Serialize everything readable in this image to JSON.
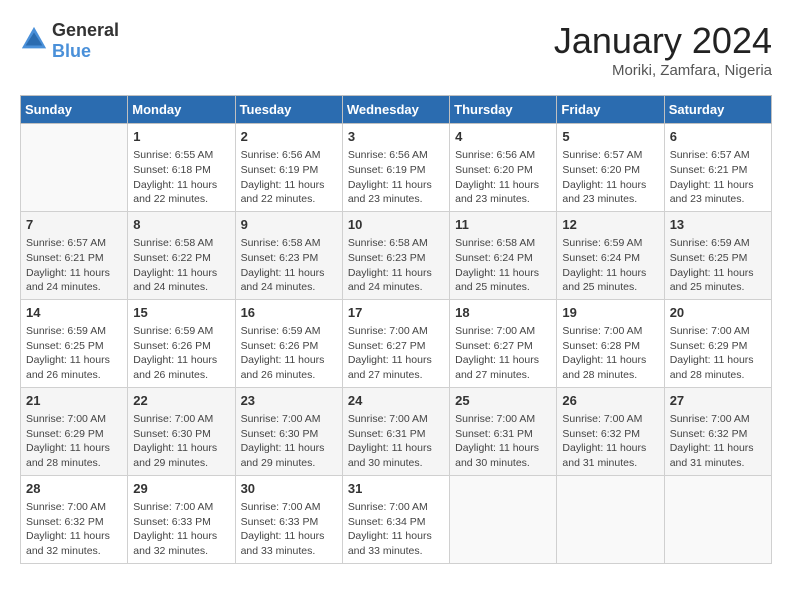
{
  "logo": {
    "general": "General",
    "blue": "Blue"
  },
  "calendar": {
    "title": "January 2024",
    "subtitle": "Moriki, Zamfara, Nigeria"
  },
  "weekdays": [
    "Sunday",
    "Monday",
    "Tuesday",
    "Wednesday",
    "Thursday",
    "Friday",
    "Saturday"
  ],
  "weeks": [
    [
      {
        "day": "",
        "info": ""
      },
      {
        "day": "1",
        "info": "Sunrise: 6:55 AM\nSunset: 6:18 PM\nDaylight: 11 hours\nand 22 minutes."
      },
      {
        "day": "2",
        "info": "Sunrise: 6:56 AM\nSunset: 6:19 PM\nDaylight: 11 hours\nand 22 minutes."
      },
      {
        "day": "3",
        "info": "Sunrise: 6:56 AM\nSunset: 6:19 PM\nDaylight: 11 hours\nand 23 minutes."
      },
      {
        "day": "4",
        "info": "Sunrise: 6:56 AM\nSunset: 6:20 PM\nDaylight: 11 hours\nand 23 minutes."
      },
      {
        "day": "5",
        "info": "Sunrise: 6:57 AM\nSunset: 6:20 PM\nDaylight: 11 hours\nand 23 minutes."
      },
      {
        "day": "6",
        "info": "Sunrise: 6:57 AM\nSunset: 6:21 PM\nDaylight: 11 hours\nand 23 minutes."
      }
    ],
    [
      {
        "day": "7",
        "info": "Sunrise: 6:57 AM\nSunset: 6:21 PM\nDaylight: 11 hours\nand 24 minutes."
      },
      {
        "day": "8",
        "info": "Sunrise: 6:58 AM\nSunset: 6:22 PM\nDaylight: 11 hours\nand 24 minutes."
      },
      {
        "day": "9",
        "info": "Sunrise: 6:58 AM\nSunset: 6:23 PM\nDaylight: 11 hours\nand 24 minutes."
      },
      {
        "day": "10",
        "info": "Sunrise: 6:58 AM\nSunset: 6:23 PM\nDaylight: 11 hours\nand 24 minutes."
      },
      {
        "day": "11",
        "info": "Sunrise: 6:58 AM\nSunset: 6:24 PM\nDaylight: 11 hours\nand 25 minutes."
      },
      {
        "day": "12",
        "info": "Sunrise: 6:59 AM\nSunset: 6:24 PM\nDaylight: 11 hours\nand 25 minutes."
      },
      {
        "day": "13",
        "info": "Sunrise: 6:59 AM\nSunset: 6:25 PM\nDaylight: 11 hours\nand 25 minutes."
      }
    ],
    [
      {
        "day": "14",
        "info": "Sunrise: 6:59 AM\nSunset: 6:25 PM\nDaylight: 11 hours\nand 26 minutes."
      },
      {
        "day": "15",
        "info": "Sunrise: 6:59 AM\nSunset: 6:26 PM\nDaylight: 11 hours\nand 26 minutes."
      },
      {
        "day": "16",
        "info": "Sunrise: 6:59 AM\nSunset: 6:26 PM\nDaylight: 11 hours\nand 26 minutes."
      },
      {
        "day": "17",
        "info": "Sunrise: 7:00 AM\nSunset: 6:27 PM\nDaylight: 11 hours\nand 27 minutes."
      },
      {
        "day": "18",
        "info": "Sunrise: 7:00 AM\nSunset: 6:27 PM\nDaylight: 11 hours\nand 27 minutes."
      },
      {
        "day": "19",
        "info": "Sunrise: 7:00 AM\nSunset: 6:28 PM\nDaylight: 11 hours\nand 28 minutes."
      },
      {
        "day": "20",
        "info": "Sunrise: 7:00 AM\nSunset: 6:29 PM\nDaylight: 11 hours\nand 28 minutes."
      }
    ],
    [
      {
        "day": "21",
        "info": "Sunrise: 7:00 AM\nSunset: 6:29 PM\nDaylight: 11 hours\nand 28 minutes."
      },
      {
        "day": "22",
        "info": "Sunrise: 7:00 AM\nSunset: 6:30 PM\nDaylight: 11 hours\nand 29 minutes."
      },
      {
        "day": "23",
        "info": "Sunrise: 7:00 AM\nSunset: 6:30 PM\nDaylight: 11 hours\nand 29 minutes."
      },
      {
        "day": "24",
        "info": "Sunrise: 7:00 AM\nSunset: 6:31 PM\nDaylight: 11 hours\nand 30 minutes."
      },
      {
        "day": "25",
        "info": "Sunrise: 7:00 AM\nSunset: 6:31 PM\nDaylight: 11 hours\nand 30 minutes."
      },
      {
        "day": "26",
        "info": "Sunrise: 7:00 AM\nSunset: 6:32 PM\nDaylight: 11 hours\nand 31 minutes."
      },
      {
        "day": "27",
        "info": "Sunrise: 7:00 AM\nSunset: 6:32 PM\nDaylight: 11 hours\nand 31 minutes."
      }
    ],
    [
      {
        "day": "28",
        "info": "Sunrise: 7:00 AM\nSunset: 6:32 PM\nDaylight: 11 hours\nand 32 minutes."
      },
      {
        "day": "29",
        "info": "Sunrise: 7:00 AM\nSunset: 6:33 PM\nDaylight: 11 hours\nand 32 minutes."
      },
      {
        "day": "30",
        "info": "Sunrise: 7:00 AM\nSunset: 6:33 PM\nDaylight: 11 hours\nand 33 minutes."
      },
      {
        "day": "31",
        "info": "Sunrise: 7:00 AM\nSunset: 6:34 PM\nDaylight: 11 hours\nand 33 minutes."
      },
      {
        "day": "",
        "info": ""
      },
      {
        "day": "",
        "info": ""
      },
      {
        "day": "",
        "info": ""
      }
    ]
  ]
}
